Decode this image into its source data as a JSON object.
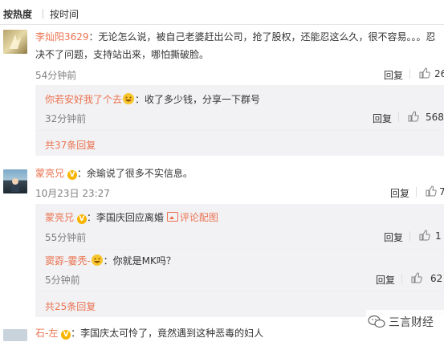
{
  "tabs": {
    "hot": "按热度",
    "time": "按时间"
  },
  "comments": [
    {
      "user": "李灿阳3629",
      "text_line1": "：无论怎么说，被自己老婆赶出公司，抢了股权，还能忍这么久，很不容易。。。忍",
      "text_line2": "决不了问题，支持站出来，哪怕撕破脸。",
      "time": "54分钟前",
      "reply": "回复",
      "likes": "26",
      "subreplies": [
        {
          "user": "你若安好我了个去",
          "text": "：收了多少钱，分享一下群号",
          "time": "32分钟前",
          "reply": "回复",
          "likes": "568"
        }
      ],
      "more": "共37条回复"
    },
    {
      "user": "蒙亮兄",
      "text": "：余瑜说了很多不实信息。",
      "time": "10月23日 23:27",
      "reply": "回复",
      "likes": "7",
      "subreplies": [
        {
          "user": "蒙亮兄",
          "text": "：李国庆回应离婚",
          "link": "评论配图",
          "time": "55分钟前",
          "reply": "回复",
          "likes": "1"
        },
        {
          "user": "窦孬-霎秃-",
          "text": "：你就是MK吗？",
          "time": "5分钟前",
          "reply": "回复",
          "likes": "62"
        }
      ],
      "more": "共25条回复"
    },
    {
      "user": "石-左",
      "text": "：李国庆太可怜了，竟然遇到这种恶毒的妇人"
    }
  ],
  "watermark": "三言财经",
  "colors": {
    "link": "#eb7350",
    "vip": "#f7b500",
    "subbg": "#f2f2f5"
  }
}
